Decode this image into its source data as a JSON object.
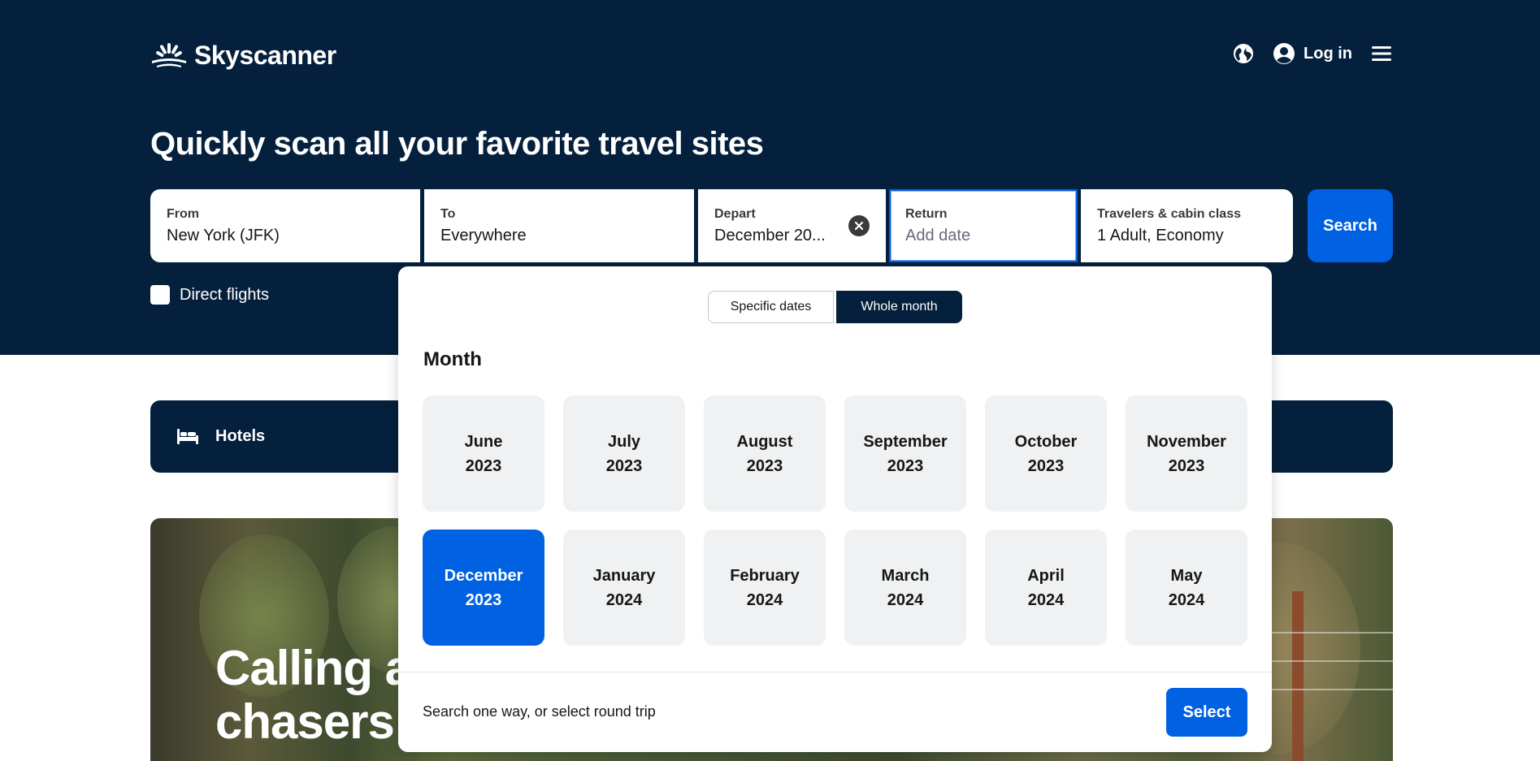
{
  "brand": {
    "name": "Skyscanner"
  },
  "nav": {
    "login_label": "Log in",
    "globe_icon": "globe-icon",
    "user_icon": "user-icon",
    "menu_icon": "hamburger-menu-icon"
  },
  "headline": "Quickly scan all your favorite travel sites",
  "search": {
    "from": {
      "label": "From",
      "value": "New York (JFK)"
    },
    "to": {
      "label": "To",
      "value": "Everywhere"
    },
    "depart": {
      "label": "Depart",
      "value": "December 20..."
    },
    "return": {
      "label": "Return",
      "placeholder": "Add date"
    },
    "travelers": {
      "label": "Travelers & cabin class",
      "value": "1 Adult, Economy"
    },
    "search_label": "Search"
  },
  "direct_flights": {
    "label": "Direct flights",
    "checked": false
  },
  "hotels_strip": {
    "label": "Hotels"
  },
  "promo": {
    "line1": "Calling a",
    "line2": "chasers"
  },
  "date_picker": {
    "mode_options": [
      "Specific dates",
      "Whole month"
    ],
    "active_mode": "Whole month",
    "section_title": "Month",
    "months": [
      {
        "month": "June",
        "year": "2023",
        "selected": false
      },
      {
        "month": "July",
        "year": "2023",
        "selected": false
      },
      {
        "month": "August",
        "year": "2023",
        "selected": false
      },
      {
        "month": "September",
        "year": "2023",
        "selected": false
      },
      {
        "month": "October",
        "year": "2023",
        "selected": false
      },
      {
        "month": "November",
        "year": "2023",
        "selected": false
      },
      {
        "month": "December",
        "year": "2023",
        "selected": true
      },
      {
        "month": "January",
        "year": "2024",
        "selected": false
      },
      {
        "month": "February",
        "year": "2024",
        "selected": false
      },
      {
        "month": "March",
        "year": "2024",
        "selected": false
      },
      {
        "month": "April",
        "year": "2024",
        "selected": false
      },
      {
        "month": "May",
        "year": "2024",
        "selected": false
      }
    ],
    "hint": "Search one way, or select round trip",
    "select_label": "Select"
  },
  "colors": {
    "navy": "#05203c",
    "accent_blue": "#0062e3",
    "tile_gray": "#eff1f2"
  }
}
